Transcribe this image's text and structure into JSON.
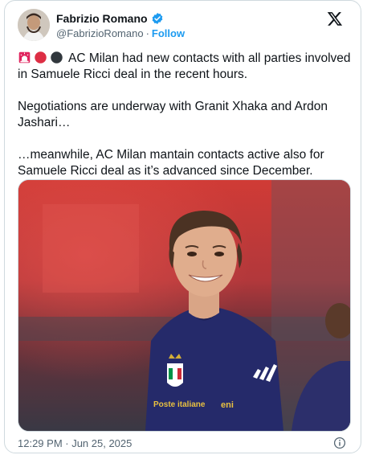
{
  "author": {
    "name": "Fabrizio Romano",
    "handle": "@FabrizioRomano",
    "separator": "·",
    "follow_label": "Follow",
    "verified_icon": "verified-badge-icon",
    "avatar_icon": "avatar-photo"
  },
  "platform_icon": "x-logo-icon",
  "tweet": {
    "emojis": [
      "rotating-light",
      "red-circle",
      "black-circle"
    ],
    "paragraphs": [
      "AC Milan had new contacts with all parties involved in Samuele Ricci deal in the recent hours.",
      "Negotiations are underway with Granit Xhaka and Ardon Jashari…",
      "…meanwhile, AC Milan mantain contacts active also for Samuele Ricci deal as it’s advanced since December."
    ]
  },
  "media": {
    "description_icon": "player-photo",
    "jersey_texts": [
      "Poste italiane",
      "eni"
    ]
  },
  "footer": {
    "timestamp": "12:29 PM · Jun 25, 2025",
    "info_icon": "info-icon"
  },
  "colors": {
    "link": "#1d9bf0",
    "muted": "#536471",
    "text": "#0f1419",
    "border": "#cfd9de"
  }
}
